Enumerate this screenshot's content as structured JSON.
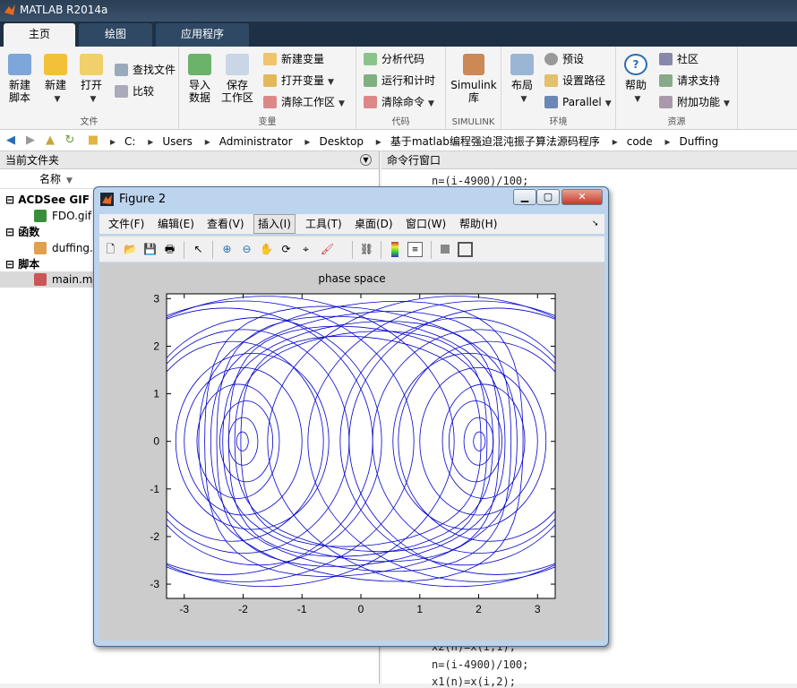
{
  "app": {
    "title": "MATLAB R2014a"
  },
  "tabs": [
    {
      "label": "主页"
    },
    {
      "label": "绘图"
    },
    {
      "label": "应用程序"
    }
  ],
  "ribbon": {
    "file": {
      "new_script": "新建\n脚本",
      "new": "新建",
      "open": "打开",
      "find_files": "查找文件",
      "compare": "比较",
      "group_label": "文件"
    },
    "variable": {
      "import_data": "导入\n数据",
      "save_workspace": "保存\n工作区",
      "new_variable": "新建变量",
      "open_variable": "打开变量",
      "clear_workspace": "清除工作区",
      "group_label": "变量"
    },
    "code": {
      "analyze_code": "分析代码",
      "run_and_time": "运行和计时",
      "clear_commands": "清除命令",
      "group_label": "代码"
    },
    "simulink": {
      "library": "Simulink\n库",
      "group_label": "SIMULINK"
    },
    "environment": {
      "layout": "布局",
      "preferences": "预设",
      "set_path": "设置路径",
      "parallel": "Parallel",
      "group_label": "环境"
    },
    "resources": {
      "help": "帮助",
      "community": "社区",
      "request_support": "请求支持",
      "add_ons": "附加功能",
      "group_label": "资源"
    }
  },
  "address": {
    "crumbs": [
      "C:",
      "Users",
      "Administrator",
      "Desktop",
      "基于matlab编程强迫混沌振子算法源码程序",
      "code",
      "Duffing"
    ]
  },
  "current_folder": {
    "title": "当前文件夹",
    "col_name": "名称",
    "groups": [
      {
        "label": "ACDSee GIF 图",
        "files": [
          "FDO.gif"
        ]
      },
      {
        "label": "函数",
        "files": [
          "duffing.m"
        ]
      },
      {
        "label": "脚本",
        "files": [
          "main.m"
        ]
      }
    ]
  },
  "command_window": {
    "title": "命令行窗口",
    "top_lines": [
      "n=(i-4900)/100;"
    ],
    "bottom_lines": [
      "x2(n)=x(i,1);",
      "n=(i-4900)/100;",
      "x1(n)=x(i,2);"
    ]
  },
  "figure": {
    "title": "Figure 2",
    "menus": [
      "文件(F)",
      "编辑(E)",
      "查看(V)",
      "插入(I)",
      "工具(T)",
      "桌面(D)",
      "窗口(W)",
      "帮助(H)"
    ],
    "active_menu_index": 3,
    "toolbar_icons": [
      "new-figure-icon",
      "open-file-icon",
      "save-icon",
      "print-icon",
      "pointer-icon",
      "zoom-in-icon",
      "zoom-out-icon",
      "pan-icon",
      "rotate-3d-icon",
      "data-cursor-icon",
      "brush-icon",
      "link-plot-icon",
      "colorbar-icon",
      "legend-icon",
      "hide-plot-tools-icon",
      "show-plot-tools-icon"
    ]
  },
  "chart_data": {
    "type": "line",
    "title": "phase space",
    "xlabel": "",
    "ylabel": "",
    "xlim": [
      -3.3,
      3.3
    ],
    "ylim": [
      -3.3,
      3.1
    ],
    "xticks": [
      -3,
      -2,
      -1,
      0,
      1,
      2,
      3
    ],
    "yticks": [
      -3,
      -2,
      -1,
      0,
      1,
      2,
      3
    ],
    "grid": false,
    "line_color": "#0000cc",
    "description_of_trajectory": "chaotic Duffing oscillator orbit circling two attractor lobes centered near x=-2 and x=2",
    "series": [
      {
        "cx": -2.0,
        "rx": [
          0.1,
          0.25,
          0.45,
          0.7,
          1.0,
          1.3,
          1.55,
          1.8,
          2.1,
          2.5,
          2.9,
          3.2
        ],
        "ry": [
          0.2,
          0.5,
          0.85,
          1.2,
          1.55,
          1.85,
          2.1,
          2.35,
          2.6,
          2.8,
          2.95,
          3.05
        ]
      },
      {
        "cx": 2.0,
        "rx": [
          0.1,
          0.25,
          0.45,
          0.7,
          1.0,
          1.3,
          1.55,
          1.8,
          2.1,
          2.5,
          2.9,
          3.2
        ],
        "ry": [
          0.2,
          0.5,
          0.85,
          1.2,
          1.55,
          1.85,
          2.1,
          2.35,
          2.6,
          2.8,
          2.95,
          3.05
        ]
      }
    ]
  },
  "colors": {
    "accent": "#1e3046",
    "plot_line": "#0000cc"
  }
}
